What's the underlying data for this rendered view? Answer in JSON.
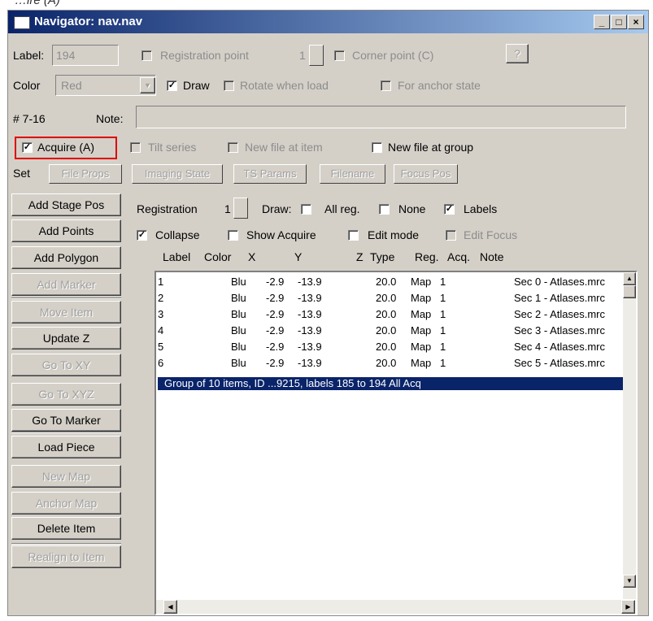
{
  "caption": "…ire (A)",
  "window": {
    "title": "Navigator:  nav.nav"
  },
  "top": {
    "label_caption": "Label:",
    "label_value": "194",
    "registration_point": "Registration point",
    "reg_num": "1",
    "corner_point": "Corner point (C)",
    "help": "?",
    "color_caption": "Color",
    "color_value": "Red",
    "draw": "Draw",
    "rotate": "Rotate when load",
    "anchor": "For anchor state",
    "item_num": "# 7-16",
    "note_caption": "Note:",
    "note_value": "",
    "acquire": "Acquire (A)",
    "tilt": "Tilt series",
    "newfile_item": "New file at item",
    "newfile_group": "New file at group",
    "set": "Set",
    "set_buttons": [
      "File Props",
      "Imaging State",
      "TS Params",
      "Filename",
      "Focus Pos"
    ]
  },
  "left_buttons": [
    "Add Stage Pos",
    "Add Points",
    "Add Polygon",
    "Add Marker",
    "Move Item",
    "Update Z",
    "Go To XY",
    "Go To XYZ",
    "Go To Marker",
    "Load Piece",
    "New Map",
    "Anchor Map",
    "Delete Item",
    "Realign to Item"
  ],
  "reg": {
    "registration": "Registration",
    "reg_value": "1",
    "draw": "Draw:",
    "all_reg": "All reg.",
    "none": "None",
    "labels": "Labels",
    "collapse": "Collapse",
    "show_acquire": "Show Acquire",
    "edit_mode": "Edit mode",
    "edit_focus": "Edit Focus"
  },
  "columns": [
    "Label",
    "Color",
    "X",
    "Y",
    "Z",
    "Type",
    "Reg.",
    "Acq.",
    "Note"
  ],
  "rows": [
    [
      "1",
      "Blu",
      "-2.9",
      "-13.9",
      "20.0",
      "Map",
      "1",
      "Sec 0 - Atlases.mrc"
    ],
    [
      "2",
      "Blu",
      "-2.9",
      "-13.9",
      "20.0",
      "Map",
      "1",
      "Sec 1 - Atlases.mrc"
    ],
    [
      "3",
      "Blu",
      "-2.9",
      "-13.9",
      "20.0",
      "Map",
      "1",
      "Sec 2 - Atlases.mrc"
    ],
    [
      "4",
      "Blu",
      "-2.9",
      "-13.9",
      "20.0",
      "Map",
      "1",
      "Sec 3 - Atlases.mrc"
    ],
    [
      "5",
      "Blu",
      "-2.9",
      "-13.9",
      "20.0",
      "Map",
      "1",
      "Sec 4 - Atlases.mrc"
    ],
    [
      "6",
      "Blu",
      "-2.9",
      "-13.9",
      "20.0",
      "Map",
      "1",
      "Sec 5 - Atlases.mrc"
    ]
  ],
  "group_row": "Group of 10 items, ID ...9215,  labels 185 to 194  All Acq",
  "colors": {
    "title_start": "#0a246a",
    "title_end": "#a6caf0",
    "face": "#d4d0c8",
    "highlight": "#e00000"
  }
}
